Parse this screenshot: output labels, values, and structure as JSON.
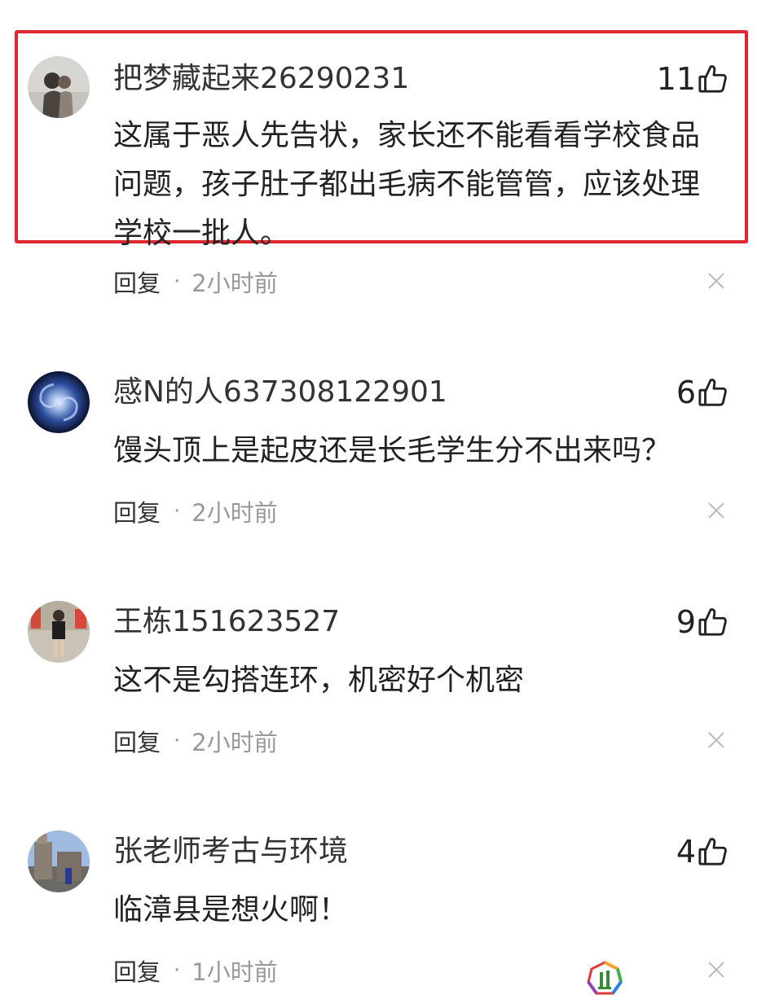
{
  "comments": [
    {
      "username": "把梦藏起来26290231",
      "likes": "11",
      "text": "这属于恶人先告状，家长还不能看看学校食品问题，孩子肚子都出毛病不能管管，应该处理学校一批人。",
      "reply_label": "回复",
      "separator": "·",
      "time": "2小时前",
      "highlighted": true,
      "avatar": "person-photo"
    },
    {
      "username": "感N的人637308122901",
      "likes": "6",
      "text": "馒头顶上是起皮还是长毛学生分不出来吗？",
      "reply_label": "回复",
      "separator": "·",
      "time": "2小时前",
      "avatar": "galaxy-image"
    },
    {
      "username": "王栋151623527",
      "likes": "9",
      "text": "这不是勾搭连环，机密好个机密",
      "reply_label": "回复",
      "separator": "·",
      "time": "2小时前",
      "avatar": "person-gym-photo"
    },
    {
      "username": "张老师考古与环境",
      "likes": "4",
      "text": "临漳县是想火啊！",
      "reply_label": "回复",
      "separator": "·",
      "time": "1小时前",
      "avatar": "building-photo"
    }
  ],
  "colors": {
    "highlight_border": "#e0262e",
    "text_primary": "#222222",
    "text_meta": "#999999"
  },
  "icons": {
    "like": "thumbs-up-icon",
    "dismiss": "close-icon"
  },
  "watermark": {
    "text": "",
    "logo": "watermark-logo"
  }
}
